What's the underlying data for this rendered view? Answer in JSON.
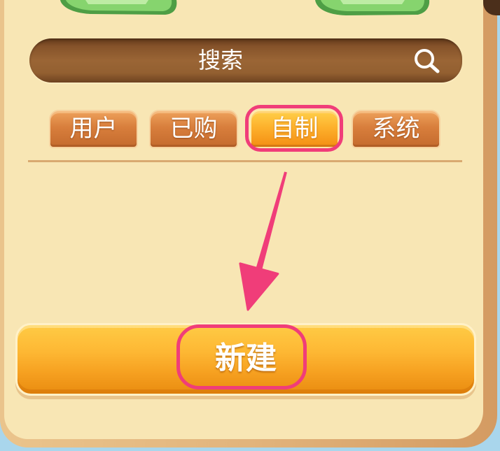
{
  "search": {
    "placeholder": "搜索",
    "icon": "search-icon"
  },
  "tabs": [
    {
      "label": "用户",
      "active": false
    },
    {
      "label": "已购",
      "active": false
    },
    {
      "label": "自制",
      "active": true
    },
    {
      "label": "系统",
      "active": false
    }
  ],
  "actions": {
    "create_label": "新建"
  },
  "decorations": {
    "top_left_icon": "money-stack-icon",
    "top_right_icon": "money-stack-icon",
    "annotation_arrow_icon": "arrow-down-icon"
  },
  "colors": {
    "panel_background": "#F8E6B4",
    "frame": "#D49B62",
    "search_bar": "#8E5A2C",
    "tab": "#C97436",
    "tab_active": "#FBA623",
    "primary_button": "#F6A425",
    "annotation": "#F03D79",
    "decoration": "#6FC25E"
  }
}
